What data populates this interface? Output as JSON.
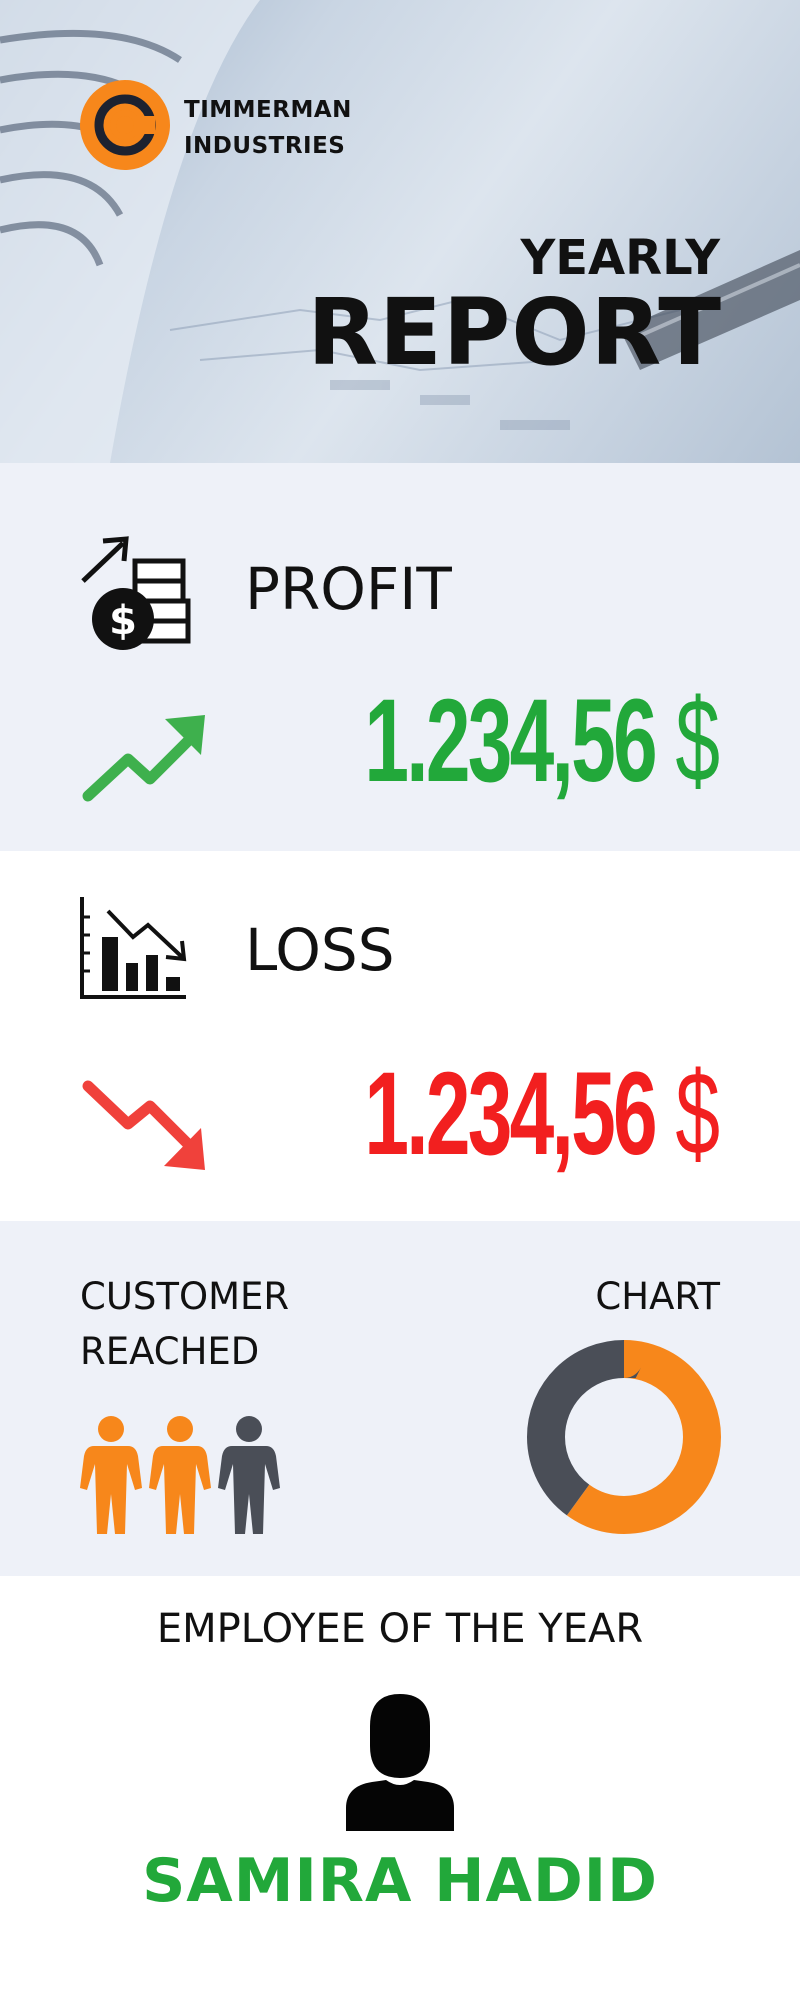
{
  "header": {
    "company_line1": "TIMMERMAN",
    "company_line2": "INDUSTRIES",
    "title_small": "YEARLY",
    "title_large": "REPORT"
  },
  "profit": {
    "label": "PROFIT",
    "amount": "1.234,56",
    "currency": "$",
    "color": "#22a83a"
  },
  "loss": {
    "label": "LOSS",
    "amount": "1.234,56",
    "currency": "$",
    "color": "#f21f1f"
  },
  "customers": {
    "label_line1": "CUSTOMER",
    "label_line2": "REACHED",
    "people_total": 3,
    "people_highlighted": 2
  },
  "chart": {
    "label": "CHART"
  },
  "chart_data": {
    "type": "pie",
    "values": [
      60,
      40
    ],
    "colors": [
      "#f7871b",
      "#4a4e57"
    ]
  },
  "employee": {
    "title": "EMPLOYEE OF THE YEAR",
    "name": "SAMIRA HADID"
  },
  "colors": {
    "accent_orange": "#f7871b",
    "dark_gray": "#4a4e57",
    "green": "#22a83a",
    "red": "#f21f1f"
  },
  "icons": [
    "logo-icon",
    "coins-icon",
    "trend-up-icon",
    "bar-chart-down-icon",
    "trend-down-icon",
    "person-icon",
    "avatar-icon"
  ]
}
